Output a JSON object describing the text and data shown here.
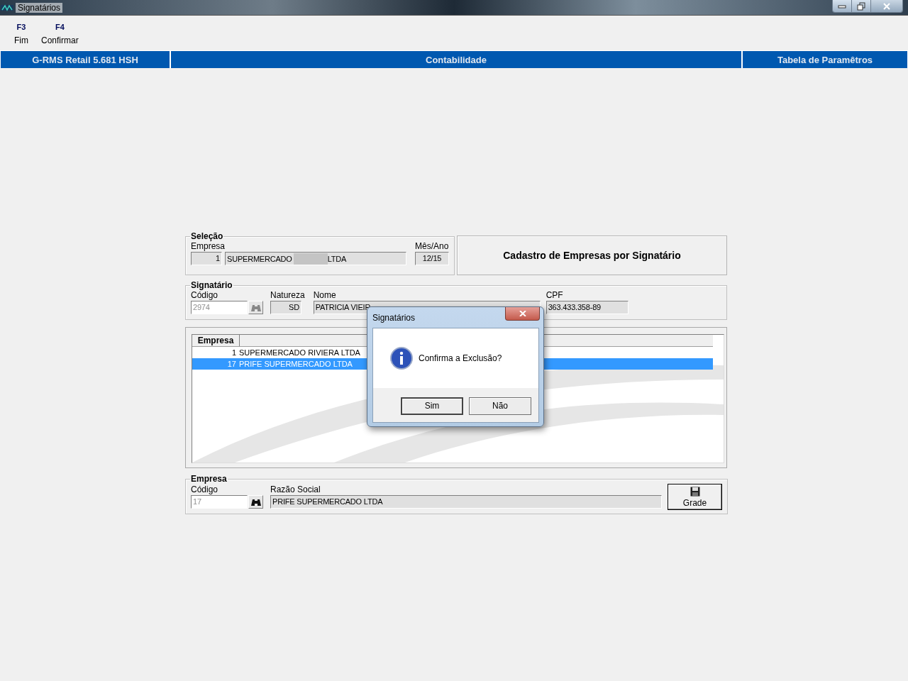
{
  "window": {
    "title": "Signatários"
  },
  "function_keys": [
    {
      "key": "F3",
      "label": "Fim"
    },
    {
      "key": "F4",
      "label": "Confirmar"
    }
  ],
  "header_bar": [
    "G-RMS Retail 5.681 HSH",
    "Contabilidade",
    "Tabela de Paramêtros"
  ],
  "selecao": {
    "title": "Seleção",
    "empresa_label": "Empresa",
    "empresa_code": "1",
    "empresa_name_parts": [
      "SUPERMERCADO",
      "LTDA"
    ],
    "mes_ano_label": "Mês/Ano",
    "mes_ano": "12/15"
  },
  "form_title": "Cadastro de Empresas por Signatário",
  "signatario": {
    "title": "Signatário",
    "codigo_label": "Código",
    "codigo": "2974",
    "natureza_label": "Natureza",
    "natureza": "SD",
    "nome_label": "Nome",
    "nome": "PATRICIA VIEIR",
    "cpf_label": "CPF",
    "cpf": "363.433.358-89"
  },
  "grid": {
    "column": "Empresa",
    "rows": [
      {
        "code": "1",
        "name": "SUPERMERCADO RIVIERA LTDA",
        "selected": false
      },
      {
        "code": "17",
        "name": "PRIFE SUPERMERCADO LTDA",
        "selected": true
      }
    ]
  },
  "empresa": {
    "title": "Empresa",
    "codigo_label": "Código",
    "codigo": "17",
    "razao_label": "Razão Social",
    "razao": "PRIFE SUPERMERCADO LTDA",
    "button": "Grade"
  },
  "dialog": {
    "title": "Signatários",
    "message": "Confirma a Exclusão?",
    "buttons": [
      "Sim",
      "Não"
    ]
  }
}
